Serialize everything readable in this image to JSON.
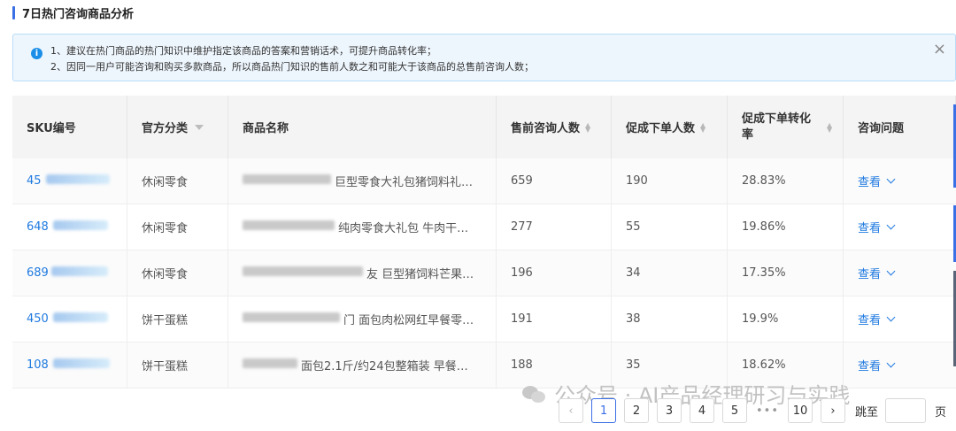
{
  "header": {
    "title": "7日热门咨询商品分析"
  },
  "notice": {
    "line1": "1、建议在热门商品的热门知识中维护指定该商品的答案和营销话术，可提升商品转化率；",
    "line2": "2、因同一用户可能咨询和购买多款商品，所以商品热门知识的售前人数之和可能大于该商品的总售前咨询人数；"
  },
  "table": {
    "columns": [
      "SKU编号",
      "官方分类",
      "商品名称",
      "售前咨询人数",
      "促成下单人数",
      "促成下单转化率",
      "咨询问题"
    ],
    "rows": [
      {
        "sku": "45",
        "category": "休闲零食",
        "name": "巨型零食大礼包猪饲料礼…",
        "consult": "659",
        "orders": "190",
        "rate": "28.83%",
        "action": "查看"
      },
      {
        "sku": "648",
        "category": "休闲零食",
        "name": "纯肉零食大礼包 牛肉干…",
        "consult": "277",
        "orders": "55",
        "rate": "19.86%",
        "action": "查看"
      },
      {
        "sku": "689",
        "category": "休闲零食",
        "name": "友 巨型猪饲料芒果…",
        "consult": "196",
        "orders": "34",
        "rate": "17.35%",
        "action": "查看"
      },
      {
        "sku": "450",
        "category": "饼干蛋糕",
        "name": "门 面包肉松网红早餐零…",
        "consult": "191",
        "orders": "38",
        "rate": "19.9%",
        "action": "查看"
      },
      {
        "sku": "108",
        "category": "饼干蛋糕",
        "name": "面包2.1斤/约24包整箱装 早餐…",
        "consult": "188",
        "orders": "35",
        "rate": "18.62%",
        "action": "查看"
      }
    ]
  },
  "watermark": {
    "text": "公众号 · AI产品经理研习与实践"
  },
  "pagination": {
    "pages": [
      "1",
      "2",
      "3",
      "4",
      "5"
    ],
    "ellipsis": "•••",
    "last_page": "10",
    "current": "1",
    "jump_label": "跳至",
    "page_unit": "页"
  },
  "colors": {
    "accent": "#3b6fe6",
    "link": "#1f7ae0",
    "notice_bg": "#eef6fd",
    "notice_border": "#b8dcf8"
  }
}
